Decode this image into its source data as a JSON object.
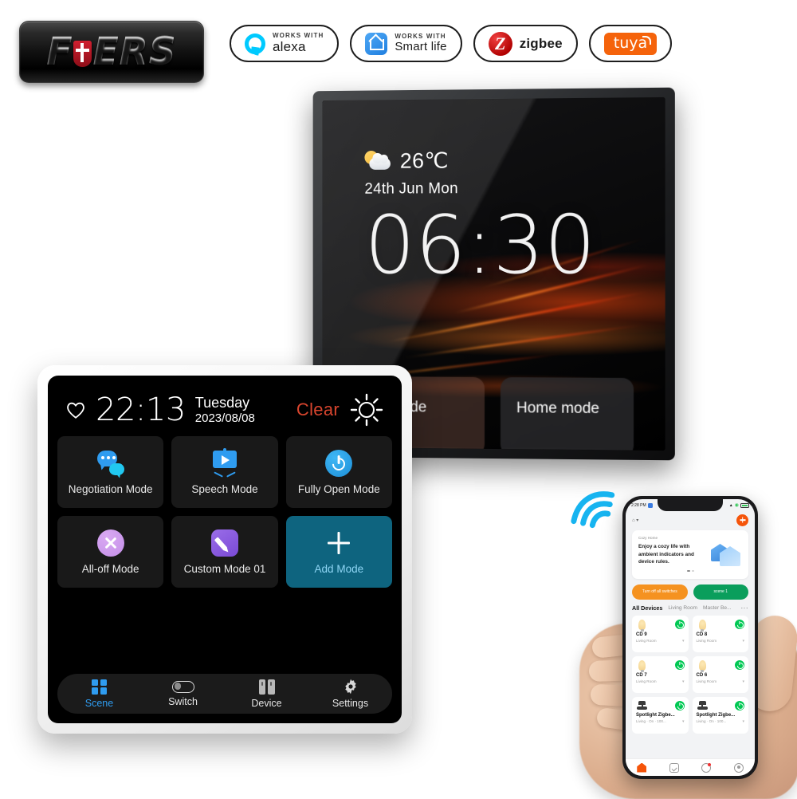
{
  "brand": {
    "name": "FUERS",
    "shield_icon": "shield-icon"
  },
  "certifications": [
    {
      "works_with": "WORKS WITH",
      "name": "alexa",
      "icon": "alexa-icon"
    },
    {
      "works_with": "WORKS WITH",
      "name": "Smart life",
      "icon": "smart-life-icon"
    },
    {
      "name": "zigbee",
      "icon": "zigbee-icon",
      "mark": "Z"
    },
    {
      "name": "tuya",
      "icon": "tuya-icon"
    }
  ],
  "black_panel": {
    "weather_icon": "sun-behind-cloud-icon",
    "temperature": "26℃",
    "date": "24th Jun  Mon",
    "clock": "06:30",
    "modes": [
      {
        "label": "ve mode",
        "icon": "house-icon"
      },
      {
        "label": "Home mode",
        "icon": "house-person-icon"
      }
    ]
  },
  "white_panel": {
    "header": {
      "favorite_icon": "heart-icon",
      "clock": "22:13",
      "weekday": "Tuesday",
      "date": "2023/08/08",
      "condition": "Clear",
      "condition_color": "#d8452e",
      "weather_icon": "sun-outline-icon"
    },
    "scenes": [
      {
        "label": "Negotiation Mode",
        "icon": "chat-bubbles-icon",
        "accent": "#2f9cf0"
      },
      {
        "label": "Speech Mode",
        "icon": "projector-screen-icon",
        "accent": "#2f9cf0"
      },
      {
        "label": "Fully Open Mode",
        "icon": "power-icon",
        "accent": "#1d8fd8"
      },
      {
        "label": "All-off Mode",
        "icon": "x-circle-icon",
        "accent": "#c48fe8"
      },
      {
        "label": "Custom Mode 01",
        "icon": "pencil-icon",
        "accent": "#7a4ad6"
      },
      {
        "label": "Add Mode",
        "icon": "plus-icon",
        "accent": "#0e647f"
      }
    ],
    "nav": [
      {
        "label": "Scene",
        "icon": "grid-icon",
        "active": true
      },
      {
        "label": "Switch",
        "icon": "toggle-icon",
        "active": false
      },
      {
        "label": "Device",
        "icon": "device-icon",
        "active": false
      },
      {
        "label": "Settings",
        "icon": "gear-icon",
        "active": false
      }
    ]
  },
  "wifi_icon": "wifi-signal-icon",
  "phone": {
    "status": {
      "time": "2:28 PM",
      "battery_icon": "battery-icon",
      "wifi_icon": "wifi-icon",
      "signal_icon": "signal-icon"
    },
    "home_name": "⌂  ▾",
    "add_button": "add-button",
    "promo": {
      "title": "Cozy Home",
      "text": "Enjoy a cozy life with ambient indicators and device rules."
    },
    "quick_actions": [
      {
        "label": "Turn off all switches",
        "color": "#f59220"
      },
      {
        "label": "scene 1",
        "color": "#0a9e5c"
      }
    ],
    "room_tabs": [
      {
        "label": "All Devices",
        "active": true
      },
      {
        "label": "Living Room",
        "active": false
      },
      {
        "label": "Master Be...",
        "active": false
      }
    ],
    "room_more": "···",
    "devices": [
      {
        "name": "CD 9",
        "room": "Living Room",
        "icon": "bulb-icon",
        "state": "on"
      },
      {
        "name": "CD 8",
        "room": "Living Room",
        "icon": "bulb-icon",
        "state": "on"
      },
      {
        "name": "CD 7",
        "room": "Living Room",
        "icon": "bulb-icon",
        "state": "on"
      },
      {
        "name": "CD 6",
        "room": "Living Room",
        "icon": "bulb-icon",
        "state": "on"
      },
      {
        "name": "Spotlight Zigbe...",
        "room": "Living · On · 100...",
        "icon": "spotlight-icon",
        "state": "on"
      },
      {
        "name": "Spotlight Zigbe...",
        "room": "Living · On · 100...",
        "icon": "spotlight-icon",
        "state": "on"
      }
    ],
    "tabbar": [
      {
        "icon": "home-tab-icon",
        "active": true
      },
      {
        "icon": "scene-tab-icon",
        "active": false
      },
      {
        "icon": "smart-tab-icon",
        "active": false
      },
      {
        "icon": "profile-tab-icon",
        "active": false
      }
    ]
  }
}
